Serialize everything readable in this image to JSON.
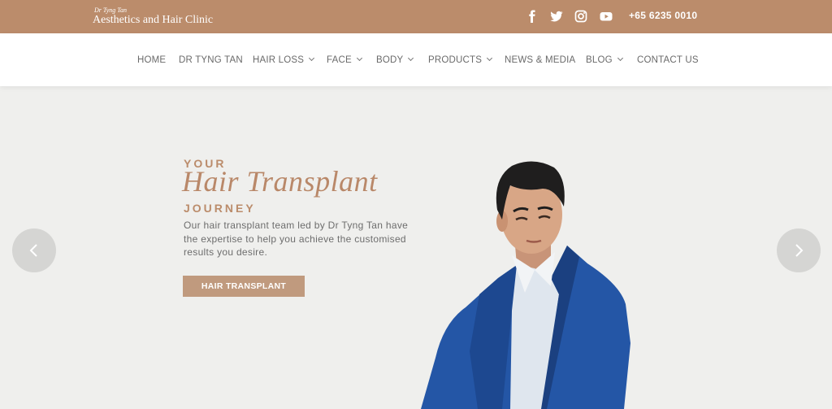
{
  "topbar": {
    "logo_script": "Dr Tyng Tan",
    "logo_main": "Aesthetics and Hair Clinic",
    "social_icons": [
      "facebook-icon",
      "twitter-icon",
      "instagram-icon",
      "youtube-icon"
    ],
    "phone": "+65 6235 0010",
    "background": "#bb8c6b"
  },
  "nav": {
    "items": [
      {
        "label": "HOME"
      },
      {
        "label": "DR TYNG TAN"
      },
      {
        "label": "HAIR LOSS"
      },
      {
        "label": "FACE"
      },
      {
        "label": "BODY"
      },
      {
        "label": "PRODUCTS"
      },
      {
        "label": "NEWS & MEDIA"
      },
      {
        "label": "BLOG"
      },
      {
        "label": "CONTACT US"
      }
    ]
  },
  "hero": {
    "your": "YOUR",
    "script": "Hair Transplant",
    "journey": "JOURNEY",
    "description": "Our hair transplant team led by Dr Tyng Tan have the expertise to help you achieve the customised results you desire.",
    "cta": "HAIR TRANSPLANT",
    "accent": "#bb8c6b"
  },
  "slider": {
    "prev_icon": "chevron-left-icon",
    "next_icon": "chevron-right-icon"
  }
}
